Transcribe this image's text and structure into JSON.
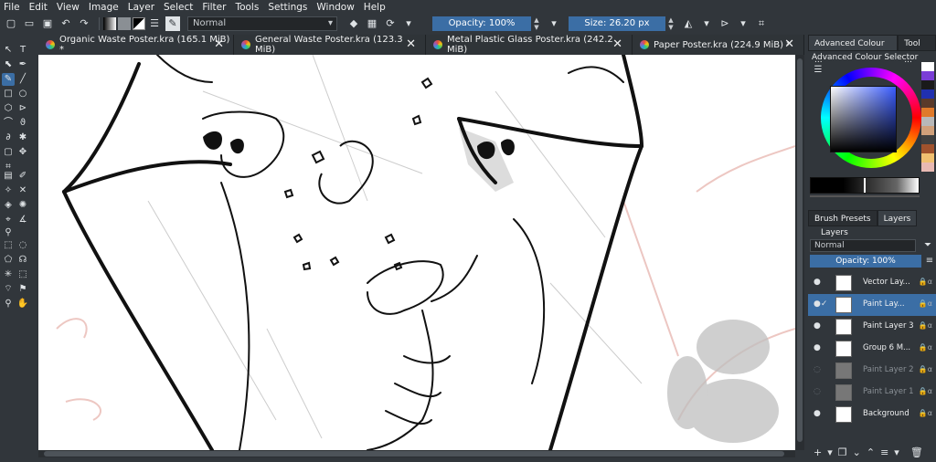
{
  "menu": [
    "File",
    "Edit",
    "View",
    "Image",
    "Layer",
    "Select",
    "Filter",
    "Tools",
    "Settings",
    "Window",
    "Help"
  ],
  "toolbar": {
    "blend_mode": "Normal",
    "opacity": "Opacity: 100%",
    "size": "Size: 26.20 px"
  },
  "tabs": [
    {
      "label": "Organic Waste Poster.kra (165.1 MiB) *",
      "active": true
    },
    {
      "label": "General Waste Poster.kra (123.3 MiB)",
      "active": false
    },
    {
      "label": "Metal Plastic Glass Poster.kra (242.2 MiB)",
      "active": false
    },
    {
      "label": "Paper Poster.kra (224.9 MiB) *",
      "active": false
    }
  ],
  "docker": {
    "top_tabs": [
      "Advanced Colour ...",
      "Tool ..."
    ],
    "colour_selector_title": "Advanced Colour Selector",
    "bottom_tabs": [
      "Brush Presets",
      "Layers"
    ],
    "layers_title": "Layers",
    "layer_blend": "Normal",
    "layer_opacity": "Opacity:  100%",
    "layers": [
      {
        "name": "Vector Lay...",
        "visible": true,
        "active": false
      },
      {
        "name": "Paint Lay...",
        "visible": true,
        "active": true
      },
      {
        "name": "Paint Layer 3",
        "visible": true,
        "active": false
      },
      {
        "name": "Group 6 M...",
        "visible": true,
        "active": false
      },
      {
        "name": "Paint Layer 2",
        "visible": false,
        "active": false
      },
      {
        "name": "Paint Layer 1",
        "visible": false,
        "active": false
      },
      {
        "name": "Background",
        "visible": true,
        "active": false
      }
    ]
  },
  "colors": {
    "accent": "#3b6ea5",
    "panel": "#31363b"
  }
}
